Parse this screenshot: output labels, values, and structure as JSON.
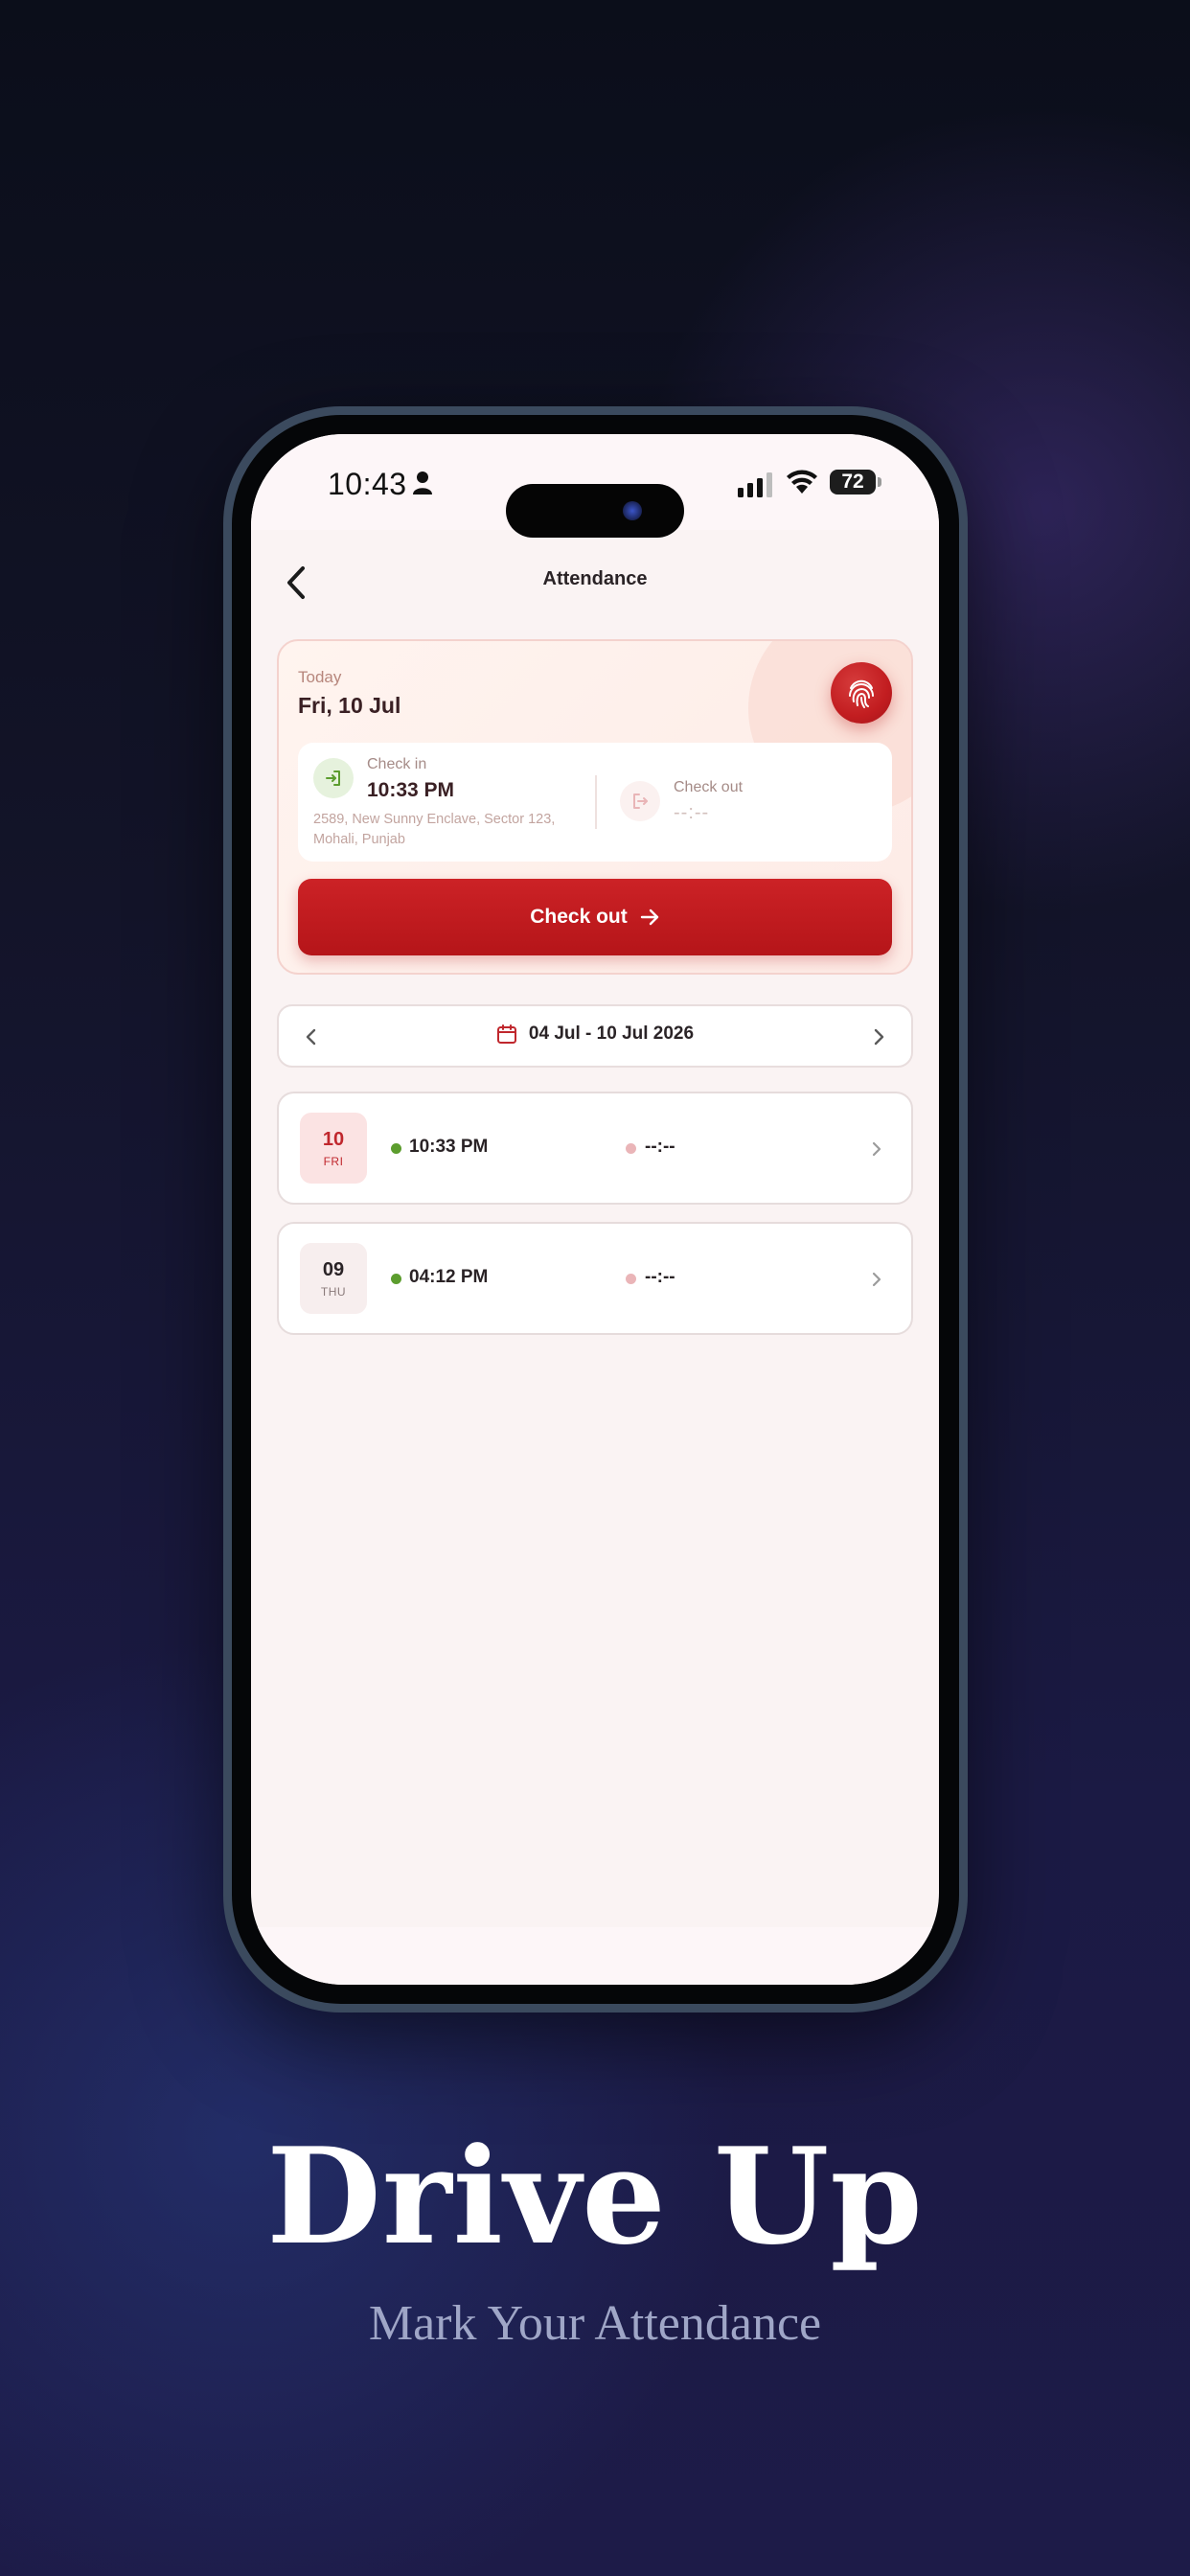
{
  "status_bar": {
    "time": "10:43",
    "battery": "72"
  },
  "header": {
    "title": "Attendance"
  },
  "today": {
    "label": "Today",
    "date": "Fri, 10 Jul",
    "check_in": {
      "label": "Check in",
      "time": "10:33 PM",
      "address": "2589, New Sunny Enclave, Sector 123, Mohali, Punjab"
    },
    "check_out": {
      "label": "Check out",
      "time": "--:--"
    },
    "checkout_button": "Check out"
  },
  "range": {
    "label": "04 Jul - 10 Jul 2026"
  },
  "records": [
    {
      "day": "10",
      "dow": "FRI",
      "check_in": "10:33 PM",
      "check_out": "--:--"
    },
    {
      "day": "09",
      "dow": "THU",
      "check_in": "04:12 PM",
      "check_out": "--:--"
    }
  ],
  "marketing": {
    "title": "Drive Up",
    "subtitle": "Mark Your Attendance"
  },
  "colors": {
    "accent": "#c21d20",
    "check_in_dot": "#5c9d2e",
    "check_out_dot": "#eab5b8"
  }
}
